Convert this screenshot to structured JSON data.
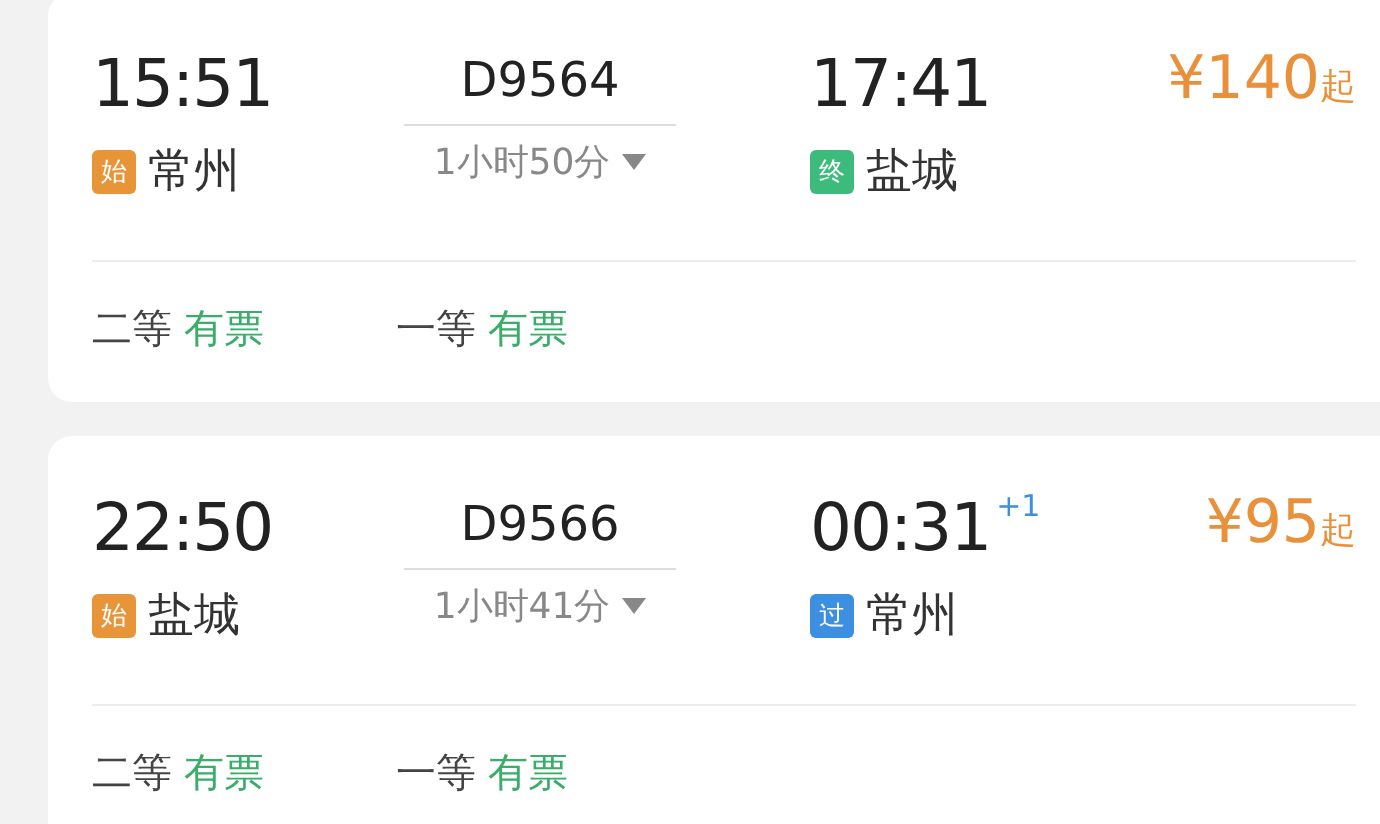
{
  "trains": [
    {
      "depart_time": "15:51",
      "depart_badge": {
        "label": "始",
        "color": "#e8953a"
      },
      "depart_station": "常州",
      "train_no": "D9564",
      "duration": "1小时50分",
      "arrive_time": "17:41",
      "arrive_badge": {
        "label": "终",
        "color": "#3dbb7d"
      },
      "arrive_station": "盐城",
      "price": "¥140",
      "price_suffix": "起",
      "seats": [
        {
          "class": "二等",
          "status": "有票"
        },
        {
          "class": "一等",
          "status": "有票"
        }
      ]
    },
    {
      "depart_time": "22:50",
      "depart_badge": {
        "label": "始",
        "color": "#e8953a"
      },
      "depart_station": "盐城",
      "train_no": "D9566",
      "duration": "1小时41分",
      "arrive_time": "00:31",
      "day_offset": "+1",
      "arrive_badge": {
        "label": "过",
        "color": "#3d8fe0"
      },
      "arrive_station": "常州",
      "price": "¥95",
      "price_suffix": "起",
      "seats": [
        {
          "class": "二等",
          "status": "有票"
        },
        {
          "class": "一等",
          "status": "有票"
        }
      ]
    }
  ]
}
